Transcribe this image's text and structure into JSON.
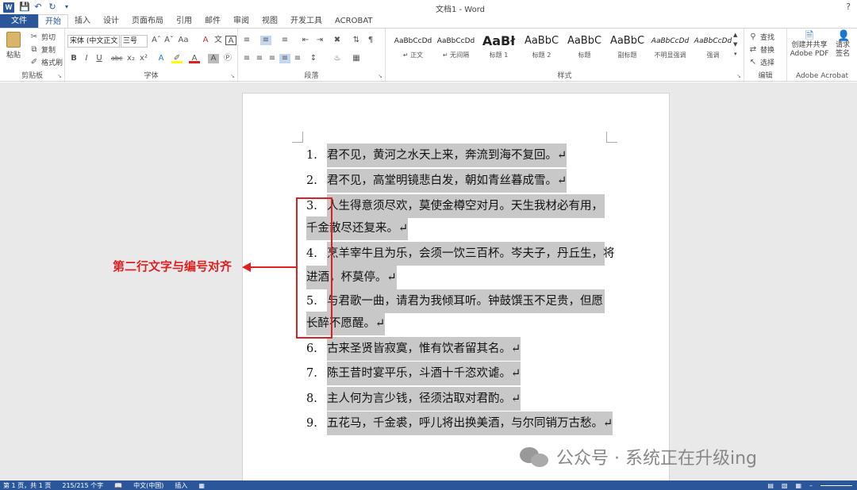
{
  "window": {
    "title": "文档1 - Word",
    "help": "?"
  },
  "qat": {
    "logo": "W",
    "icons": [
      "save-icon",
      "undo-icon",
      "redo-icon"
    ]
  },
  "tabs": [
    "文件",
    "开始",
    "插入",
    "设计",
    "页面布局",
    "引用",
    "邮件",
    "审阅",
    "视图",
    "开发工具",
    "ACROBAT"
  ],
  "ribbon": {
    "clipboard": {
      "paste": "粘贴",
      "cut": "剪切",
      "copy": "复制",
      "format_painter": "格式刷",
      "label": "剪贴板"
    },
    "font": {
      "font_name": "宋体 (中文正文",
      "font_size": "三号",
      "label": "字体"
    },
    "paragraph": {
      "label": "段落"
    },
    "styles": {
      "label": "样式",
      "items": [
        {
          "preview": "AaBbCcDd",
          "name": "↵ 正文"
        },
        {
          "preview": "AaBbCcDd",
          "name": "↵ 无间隔"
        },
        {
          "preview": "AaBł",
          "name": "标题 1"
        },
        {
          "preview": "AaBbC",
          "name": "标题 2"
        },
        {
          "preview": "AaBbC",
          "name": "标题"
        },
        {
          "preview": "AaBbC",
          "name": "副标题"
        },
        {
          "preview": "AaBbCcDd",
          "name": "不明显强调"
        },
        {
          "preview": "AaBbCcDd",
          "name": "强调"
        }
      ]
    },
    "editing": {
      "find": "查找",
      "replace": "替换",
      "select": "选择",
      "label": "编辑"
    },
    "acrobat": {
      "create": "创建并共享",
      "create2": "Adobe PDF",
      "request": "请求",
      "request2": "签名",
      "label": "Adobe Acrobat"
    }
  },
  "document": {
    "items": [
      {
        "num": "1.",
        "line1": "君不见，黄河之水天上来，奔流到海不复回。↵"
      },
      {
        "num": "2.",
        "line1": "君不见，高堂明镜悲白发，朝如青丝暮成雪。↵"
      },
      {
        "num": "3.",
        "line1": "人生得意须尽欢，莫使金樽空对月。天生我材必有用，",
        "line2": "千金散尽还复来。↵"
      },
      {
        "num": "4.",
        "line1": "烹羊宰牛且为乐，会须一饮三百杯。岑夫子，丹丘生，将",
        "line2": "进酒，杯莫停。↵"
      },
      {
        "num": "5.",
        "line1": "与君歌一曲，请君为我倾耳听。钟鼓馔玉不足贵，但愿",
        "line2": "长醉不愿醒。↵"
      },
      {
        "num": "6.",
        "line1": "古来圣贤皆寂寞，惟有饮者留其名。↵"
      },
      {
        "num": "7.",
        "line1": "陈王昔时宴平乐，斗酒十千恣欢谑。↵"
      },
      {
        "num": "8.",
        "line1": "主人何为言少钱，径须沽取对君酌。↵"
      },
      {
        "num": "9.",
        "line1": "五花马，千金裘，呼儿将出换美酒，与尔同销万古愁。↵"
      }
    ]
  },
  "annotation": {
    "text": "第二行文字与编号对齐",
    "color": "#e02020"
  },
  "watermark": {
    "text": "公众号 · 系统正在升级ing"
  },
  "status": {
    "page": "第 1 页，共 1 页",
    "words": "215/215 个字",
    "lang": "中文(中国)",
    "mode": "插入"
  },
  "colors": {
    "accent": "#2b579a",
    "highlight": "#c8c8c8"
  }
}
